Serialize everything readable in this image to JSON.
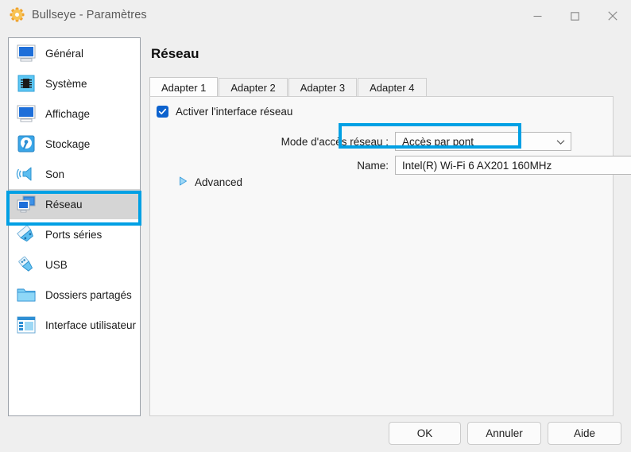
{
  "window": {
    "title": "Bullseye - Paramètres",
    "app_icon": "gear-icon",
    "controls": {
      "minimize": "minimize-icon",
      "maximize": "maximize-icon",
      "close": "close-icon"
    }
  },
  "colors": {
    "accent_highlight": "#00a0e4",
    "checkbox_blue": "#0c62ce",
    "selected_row": "#d5d5d5",
    "window_bg": "#efefef",
    "pane_bg": "#f8f8f8"
  },
  "sidebar": {
    "items": [
      {
        "label": "Général",
        "icon": "monitor-icon",
        "selected": false
      },
      {
        "label": "Système",
        "icon": "cpu-chip-icon",
        "selected": false
      },
      {
        "label": "Affichage",
        "icon": "display-icon",
        "selected": false
      },
      {
        "label": "Stockage",
        "icon": "hard-disk-icon",
        "selected": false
      },
      {
        "label": "Son",
        "icon": "speaker-icon",
        "selected": false
      },
      {
        "label": "Réseau",
        "icon": "network-icon",
        "selected": true
      },
      {
        "label": "Ports séries",
        "icon": "serial-port-icon",
        "selected": false
      },
      {
        "label": "USB",
        "icon": "usb-icon",
        "selected": false
      },
      {
        "label": "Dossiers partagés",
        "icon": "folder-icon",
        "selected": false
      },
      {
        "label": "Interface utilisateur",
        "icon": "user-interface-icon",
        "selected": false
      }
    ]
  },
  "main": {
    "page_title": "Réseau",
    "tabs": [
      {
        "label": "Adapter 1",
        "active": true
      },
      {
        "label": "Adapter 2",
        "active": false
      },
      {
        "label": "Adapter 3",
        "active": false
      },
      {
        "label": "Adapter 4",
        "active": false
      }
    ],
    "enable_adapter": {
      "label": "Activer l'interface réseau",
      "checked": true
    },
    "attached_to": {
      "label": "Mode d'accès réseau :",
      "value": "Accès par pont",
      "highlighted": true
    },
    "name": {
      "label": "Name:",
      "value": "Intel(R) Wi-Fi 6 AX201 160MHz"
    },
    "advanced": {
      "label": "Advanced",
      "expanded": false,
      "icon": "triangle-right-icon"
    }
  },
  "footer": {
    "ok": "OK",
    "cancel": "Annuler",
    "help": "Aide"
  }
}
